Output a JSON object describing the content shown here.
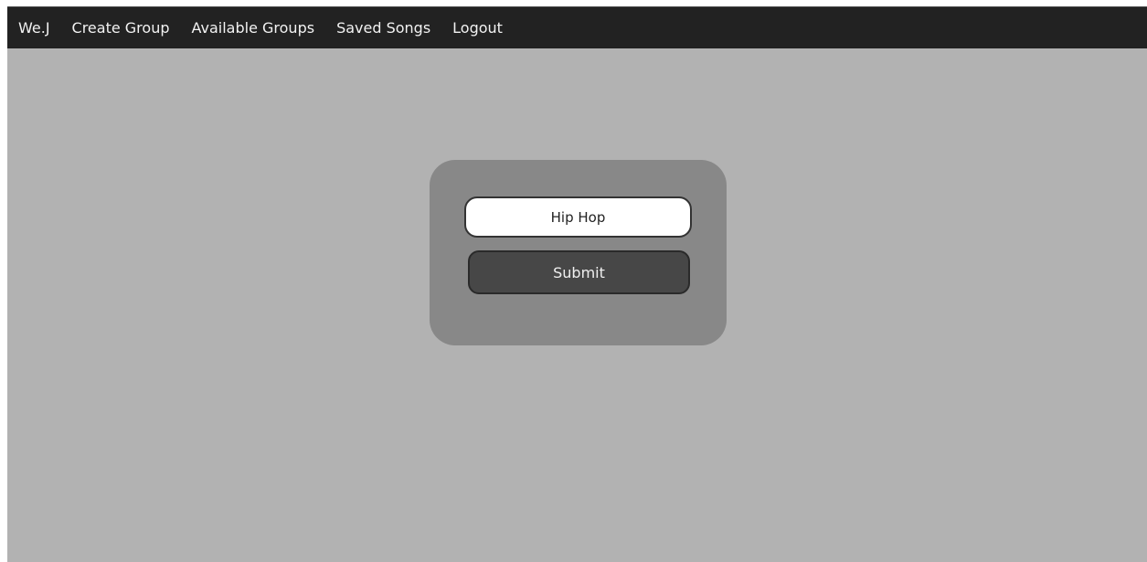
{
  "navbar": {
    "brand": "We.J",
    "items": [
      {
        "label": "Create Group"
      },
      {
        "label": "Available Groups"
      },
      {
        "label": "Saved Songs"
      },
      {
        "label": "Logout"
      }
    ]
  },
  "form": {
    "genre_value": "Hip Hop",
    "submit_label": "Submit"
  },
  "colors": {
    "navbar_bg": "#222222",
    "page_bg": "#b2b2b2",
    "card_bg": "#888888",
    "button_bg": "#474747"
  }
}
